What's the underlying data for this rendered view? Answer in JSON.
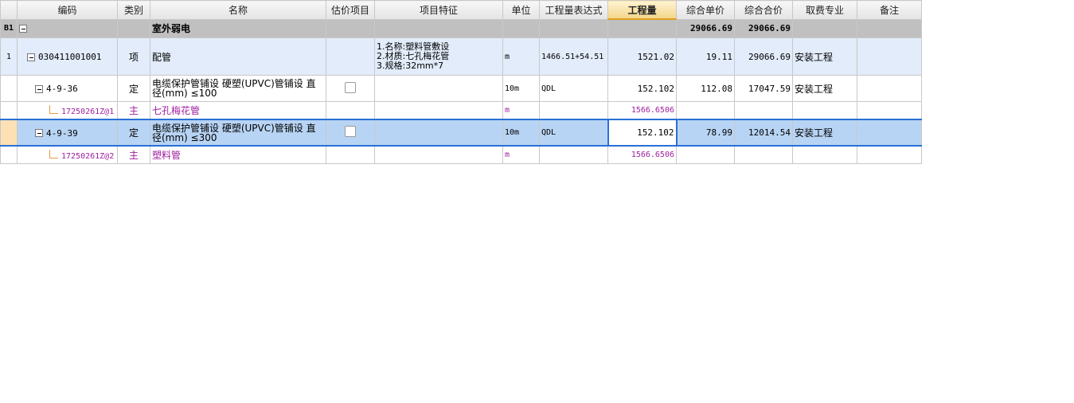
{
  "headers": {
    "rownum": "",
    "code": "编码",
    "type": "类别",
    "name": "名称",
    "estimate": "估价项目",
    "feature": "项目特征",
    "unit": "单位",
    "expr": "工程量表达式",
    "qty": "工程量",
    "unit_price": "综合单价",
    "total_price": "综合合价",
    "fee_category": "取费专业",
    "note": "备注"
  },
  "rows": {
    "head": {
      "rownum": "B1",
      "name": "室外弱电",
      "unit_price": "29066.69",
      "total_price": "29066.69"
    },
    "item": {
      "rownum": "1",
      "code": "030411001001",
      "type": "项",
      "name": "配管",
      "feature_l1": "1.名称:塑料管敷设",
      "feature_l2": "2.材质:七孔梅花管",
      "feature_l3": "3.规格:32mm*7",
      "unit": "m",
      "expr": "1466.51+54.51",
      "qty": "1521.02",
      "unit_price": "19.11",
      "total_price": "29066.69",
      "fee_category": "安装工程"
    },
    "norm1": {
      "code": "4-9-36",
      "type": "定",
      "name": "电缆保护管铺设 硬塑(UPVC)管铺设 直径(mm) ≤100",
      "unit": "10m",
      "expr": "QDL",
      "qty": "152.102",
      "unit_price": "112.08",
      "total_price": "17047.59",
      "fee_category": "安装工程"
    },
    "mat1": {
      "code": "17250261Z@1",
      "type": "主",
      "name": "七孔梅花管",
      "unit": "m",
      "qty": "1566.6506"
    },
    "norm2": {
      "code": "4-9-39",
      "type": "定",
      "name": "电缆保护管铺设 硬塑(UPVC)管铺设 直径(mm) ≤300",
      "unit": "10m",
      "expr": "QDL",
      "qty": "152.102",
      "unit_price": "78.99",
      "total_price": "12014.54",
      "fee_category": "安装工程"
    },
    "mat2": {
      "code": "17250261Z@2",
      "type": "主",
      "name": "塑料管",
      "unit": "m",
      "qty": "1566.6506"
    }
  }
}
